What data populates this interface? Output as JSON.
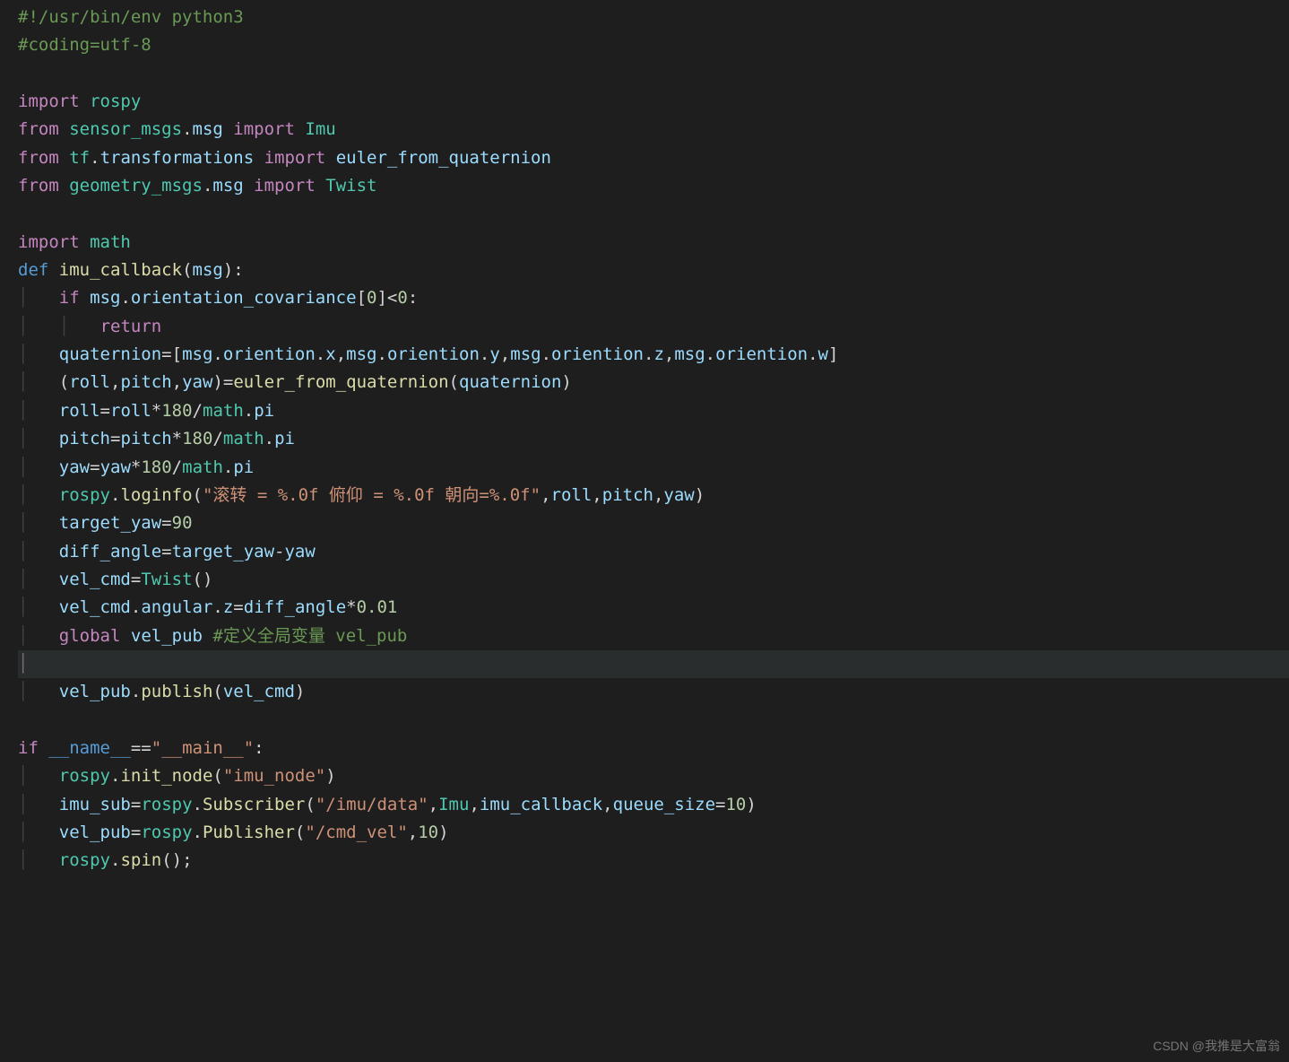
{
  "code": {
    "l1a": "#!/usr/bin/env python3",
    "l2a": "#coding=utf-8",
    "l4_import": "import",
    "l4_mod": "rospy",
    "l5_from": "from",
    "l5_mod": "sensor_msgs",
    "l5_msg": "msg",
    "l5_import": "import",
    "l5_Imu": "Imu",
    "l6_from": "from",
    "l6_mod": "tf",
    "l6_trans": "transformations",
    "l6_import": "import",
    "l6_fn": "euler_from_quaternion",
    "l7_from": "from",
    "l7_mod": "geometry_msgs",
    "l7_msg": "msg",
    "l7_import": "import",
    "l7_Twist": "Twist",
    "l9_import": "import",
    "l9_mod": "math",
    "l10_def": "def",
    "l10_fn": "imu_callback",
    "l10_arg": "msg",
    "l11_if": "if",
    "l11_msg": "msg",
    "l11_attr": "orientation_covariance",
    "l11_idx": "0",
    "l11_zero": "0",
    "l12_return": "return",
    "l13_var": "quaternion",
    "l13_msg": "msg",
    "l13_or": "oriention",
    "l13_x": "x",
    "l13_y": "y",
    "l13_z": "z",
    "l13_w": "w",
    "l14_roll": "roll",
    "l14_pitch": "pitch",
    "l14_yaw": "yaw",
    "l14_fn": "euler_from_quaternion",
    "l14_arg": "quaternion",
    "l15_roll": "roll",
    "l15_180": "180",
    "l15_math": "math",
    "l15_pi": "pi",
    "l16_pitch": "pitch",
    "l16_180": "180",
    "l16_math": "math",
    "l16_pi": "pi",
    "l17_yaw": "yaw",
    "l17_180": "180",
    "l17_math": "math",
    "l17_pi": "pi",
    "l18_rospy": "rospy",
    "l18_fn": "loginfo",
    "l18_str": "\"滚转 = %.0f 俯仰 = %.0f 朝向=%.0f\"",
    "l18_roll": "roll",
    "l18_pitch": "pitch",
    "l18_yaw": "yaw",
    "l19_var": "target_yaw",
    "l19_val": "90",
    "l20_var": "diff_angle",
    "l20_ty": "target_yaw",
    "l20_yaw": "yaw",
    "l21_var": "vel_cmd",
    "l21_Twist": "Twist",
    "l22_vel": "vel_cmd",
    "l22_ang": "angular",
    "l22_z": "z",
    "l22_da": "diff_angle",
    "l22_val": "0.01",
    "l23_global": "global",
    "l23_var": "vel_pub",
    "l23_cmt": "#定义全局变量 vel_pub",
    "l25_vel": "vel_pub",
    "l25_fn": "publish",
    "l25_arg": "vel_cmd",
    "l27_if": "if",
    "l27_name": "__name__",
    "l27_main": "\"__main__\"",
    "l28_rospy": "rospy",
    "l28_fn": "init_node",
    "l28_str": "\"imu_node\"",
    "l29_var": "imu_sub",
    "l29_rospy": "rospy",
    "l29_fn": "Subscriber",
    "l29_str": "\"/imu/data\"",
    "l29_Imu": "Imu",
    "l29_cb": "imu_callback",
    "l29_kw": "queue_size",
    "l29_val": "10",
    "l30_var": "vel_pub",
    "l30_rospy": "rospy",
    "l30_fn": "Publisher",
    "l30_str": "\"/cmd_vel\"",
    "l30_val": "10",
    "l31_rospy": "rospy",
    "l31_fn": "spin"
  },
  "watermark": "CSDN @我推是大富翁"
}
